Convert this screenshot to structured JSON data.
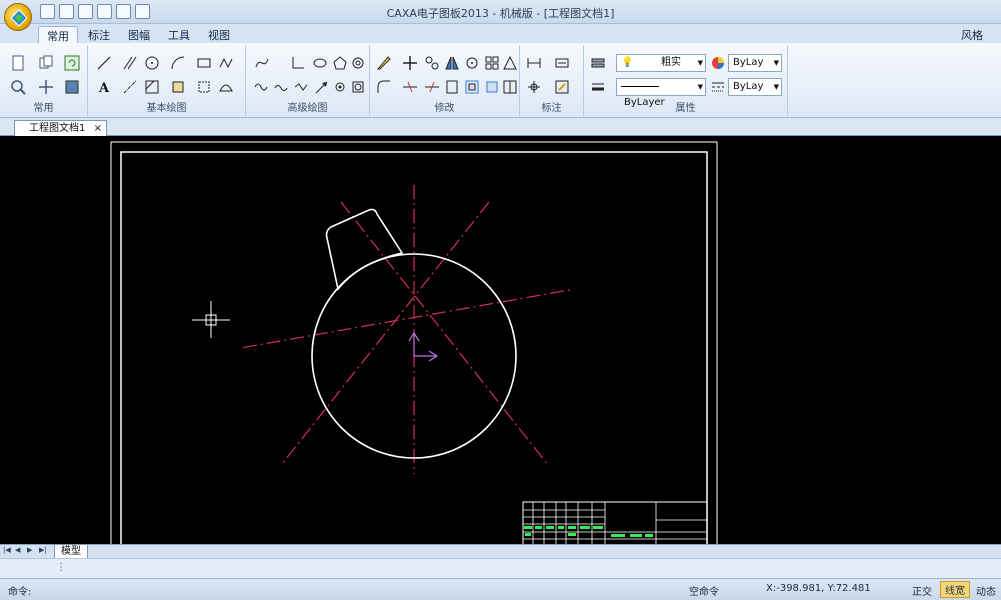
{
  "window": {
    "title": "CAXA电子图板2013 - 机械版 - [工程图文档1]"
  },
  "menu": {
    "tabs": [
      "常用",
      "标注",
      "图幅",
      "工具",
      "视图"
    ],
    "active": 0,
    "style_link": "风格"
  },
  "ribbon": {
    "groups": [
      "常用",
      "基本绘图",
      "高级绘图",
      "修改",
      "标注",
      "属性"
    ],
    "properties": {
      "line_weight": "粗实",
      "color_combo": "ByLay",
      "linetype_combo": "ByLayer",
      "linewidth_combo": "ByLay"
    }
  },
  "document": {
    "tab_title": "工程图文档1",
    "close_glyph": "×"
  },
  "model": {
    "tab_label": "模型"
  },
  "status": {
    "command_label": "命令:",
    "current_command": "空命令",
    "coordinates": "X:-398.981, Y:72.481",
    "ortho": "正交",
    "line_width": "线宽",
    "dynamic": "动态输"
  },
  "colors": {
    "drawing_outline": "#ffffff",
    "centerline": "#d2305c",
    "axis_arrow": "#c070e0",
    "title_block_text": "#33ee55"
  },
  "icons": {
    "app": "caxa-logo-icon",
    "crosshair": "crosshair-cursor-icon"
  }
}
